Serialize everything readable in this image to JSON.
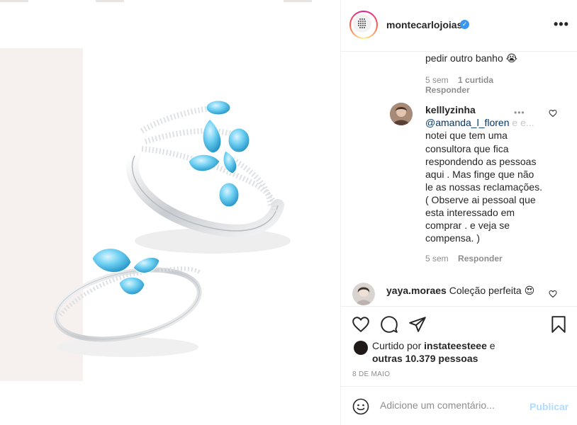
{
  "post": {
    "username": "montecarlojoias",
    "verified_icon": "verified-badge-icon",
    "more_icon": "more-options-icon"
  },
  "comments": {
    "prev_tail": {
      "text": "pedir outro banho 😭",
      "time": "5 sem",
      "likes": "1 curtida",
      "reply": "Responder"
    },
    "kelly": {
      "username": "kelllyzinha",
      "mention": "@amanda_l_floren",
      "mention_faded": "e e...",
      "lines": [
        "notei que tem uma",
        "consultora que fica",
        "respondendo as pessoas",
        "aqui . Mas finge que não",
        "le as nossas reclamações.",
        "( Observe ai pessoal que",
        "esta interessado em",
        "comprar . e veja se",
        "compensa. )"
      ],
      "time": "5 sem",
      "reply": "Responder"
    },
    "yaya": {
      "username": "yaya.moraes",
      "text": "Coleção perfeita 😍"
    }
  },
  "actions": {
    "like_icon": "heart-icon",
    "comment_icon": "comment-icon",
    "share_icon": "share-icon",
    "save_icon": "bookmark-icon"
  },
  "likes": {
    "prefix": "Curtido por",
    "user": "instateesteee",
    "conj": "e",
    "others": "outras 10.379 pessoas"
  },
  "date": "8 DE MAIO",
  "add_comment": {
    "placeholder": "Adicione um comentário...",
    "publish": "Publicar"
  },
  "colors": {
    "accent": "#3897f0",
    "publish_disabled": "#b3dbff",
    "gem": "#5ec4ea",
    "beige": "#f6f1ee"
  }
}
